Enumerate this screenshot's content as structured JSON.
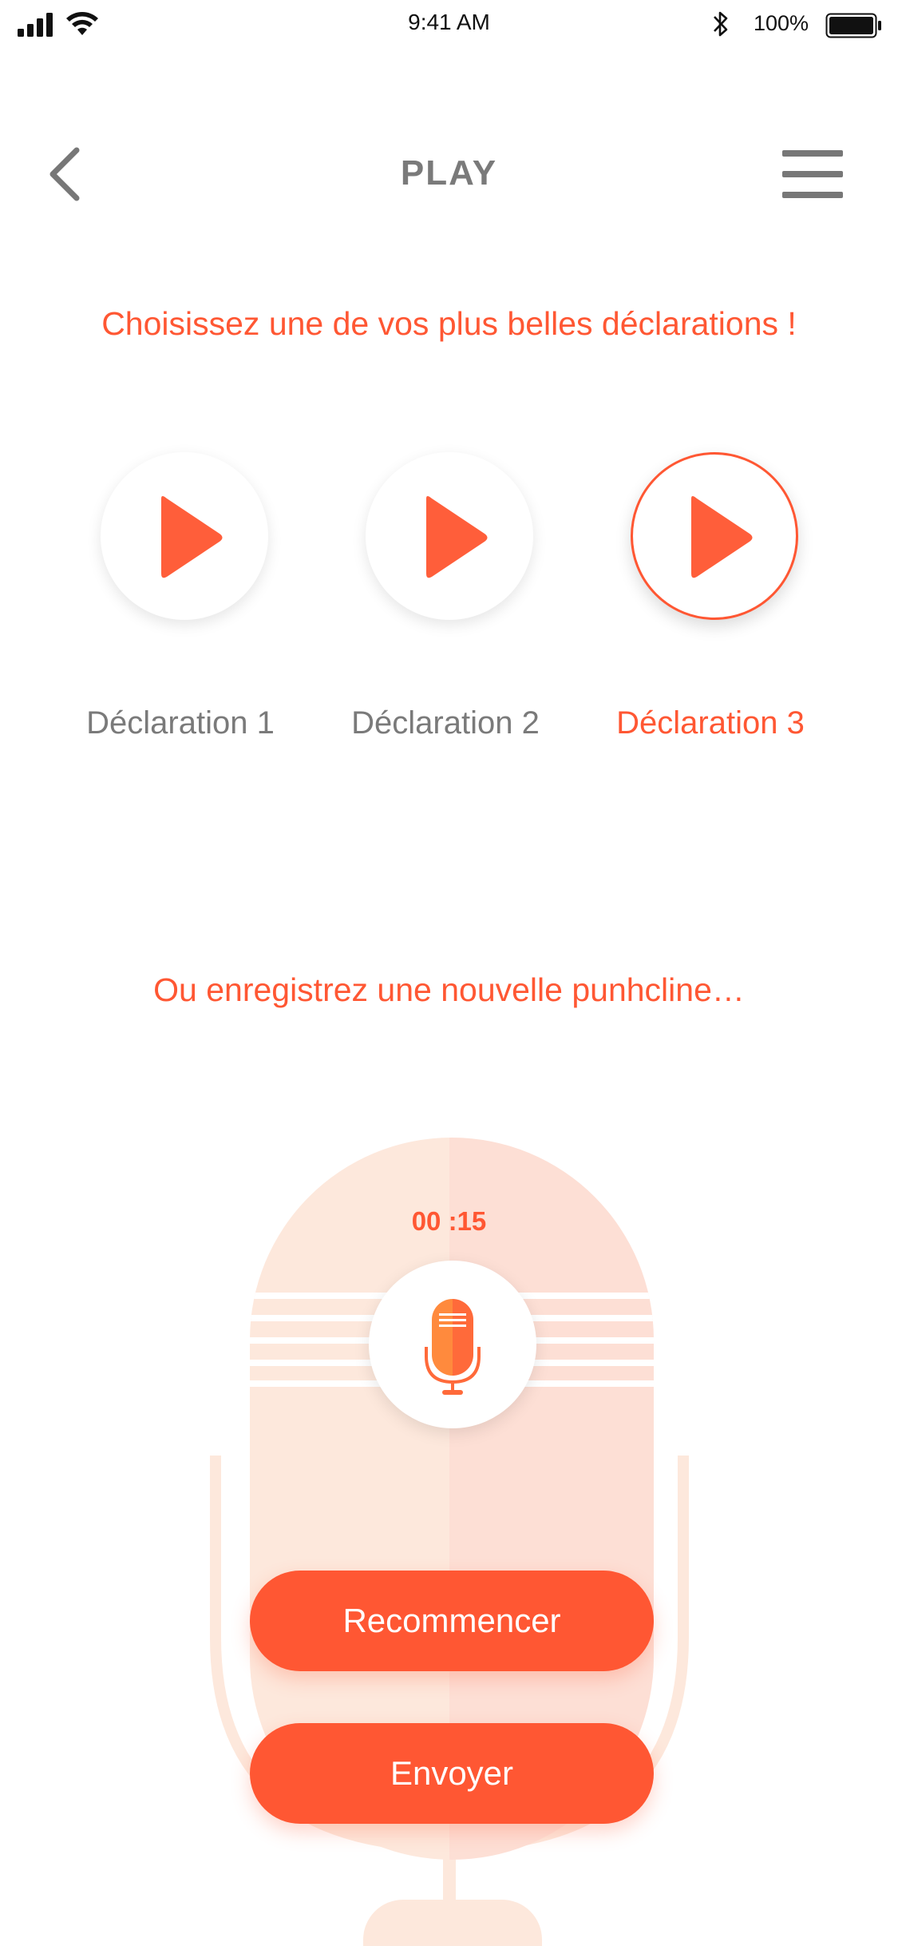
{
  "status_bar": {
    "time": "9:41 AM",
    "battery": "100%",
    "icons": [
      "signal-icon",
      "wifi-icon",
      "bluetooth-icon",
      "battery-icon"
    ]
  },
  "header": {
    "title": "PLAY",
    "back_icon": "chevron-left-icon",
    "menu_icon": "hamburger-menu-icon"
  },
  "choose_prompt": "Choisissez une de vos plus belles déclarations !",
  "declarations": [
    {
      "label": "Déclaration 1",
      "selected": false
    },
    {
      "label": "Déclaration 2",
      "selected": false
    },
    {
      "label": "Déclaration 3",
      "selected": true
    }
  ],
  "record_prompt": "Ou enregistrez une nouvelle punhcline…",
  "recorder": {
    "timer": "00 :15",
    "mic_icon": "microphone-icon"
  },
  "actions": {
    "restart_label": "Recommencer",
    "send_label": "Envoyer"
  },
  "colors": {
    "accent": "#ff5733",
    "text_grey": "#7a7a7a",
    "mic_bg_light": "#fde8dc",
    "mic_bg_dark": "#fddbd2"
  }
}
